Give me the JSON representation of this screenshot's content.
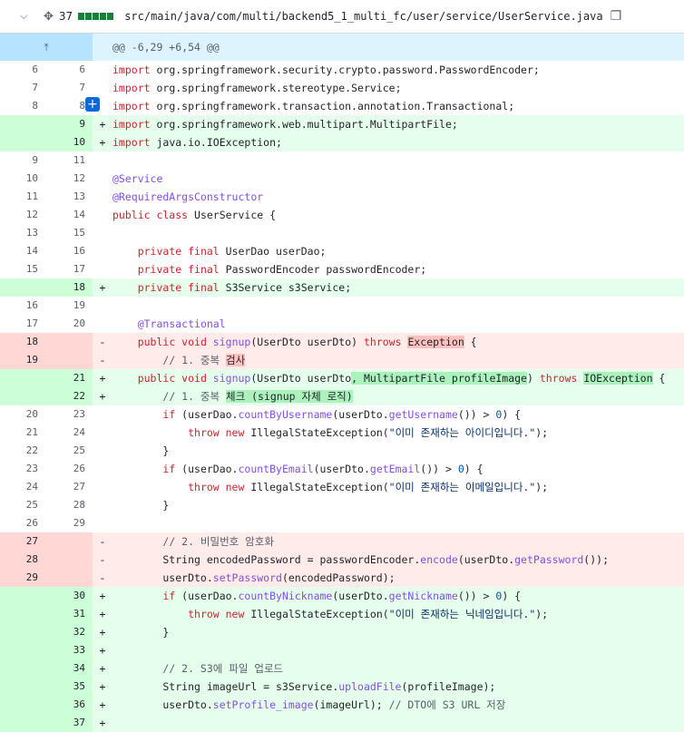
{
  "file": {
    "path": "src/main/java/com/multi/backend5_1_multi_fc/user/service/UserService.java",
    "changes": "37",
    "diffstat": [
      "add",
      "add",
      "add",
      "add",
      "add"
    ],
    "hunk": "@@ -6,29 +6,54 @@"
  },
  "lines": [
    {
      "t": "ctx",
      "o": "6",
      "n": "6",
      "s": "",
      "c": [
        [
          "kw",
          "import "
        ],
        [
          "",
          "org.springframework.security.crypto.password.PasswordEncoder;"
        ]
      ]
    },
    {
      "t": "ctx",
      "o": "7",
      "n": "7",
      "s": "",
      "c": [
        [
          "kw",
          "import "
        ],
        [
          "",
          "org.springframework.stereotype.Service;"
        ]
      ]
    },
    {
      "t": "ctx",
      "o": "8",
      "n": "8",
      "s": "",
      "c": [
        [
          "kw",
          "import "
        ],
        [
          "",
          "org.springframework.transaction.annotation.Transactional;"
        ]
      ]
    },
    {
      "t": "add",
      "o": "",
      "n": "9",
      "s": "+",
      "c": [
        [
          "kw",
          "import "
        ],
        [
          "",
          "org.springframework.web.multipart.MultipartFile;"
        ]
      ]
    },
    {
      "t": "add",
      "o": "",
      "n": "10",
      "s": "+",
      "c": [
        [
          "kw",
          "import "
        ],
        [
          "",
          "java.io.IOException;"
        ]
      ]
    },
    {
      "t": "ctx",
      "o": "9",
      "n": "11",
      "s": "",
      "c": []
    },
    {
      "t": "ctx",
      "o": "10",
      "n": "12",
      "s": "",
      "c": [
        [
          "an",
          "@Service"
        ]
      ]
    },
    {
      "t": "ctx",
      "o": "11",
      "n": "13",
      "s": "",
      "c": [
        [
          "an",
          "@RequiredArgsConstructor"
        ]
      ]
    },
    {
      "t": "ctx",
      "o": "12",
      "n": "14",
      "s": "",
      "c": [
        [
          "kw",
          "public class "
        ],
        [
          "",
          "UserService {"
        ]
      ]
    },
    {
      "t": "ctx",
      "o": "13",
      "n": "15",
      "s": "",
      "c": []
    },
    {
      "t": "ctx",
      "o": "14",
      "n": "16",
      "s": "",
      "c": [
        [
          "",
          "    "
        ],
        [
          "kw",
          "private final "
        ],
        [
          "",
          "UserDao userDao;"
        ]
      ]
    },
    {
      "t": "ctx",
      "o": "15",
      "n": "17",
      "s": "",
      "c": [
        [
          "",
          "    "
        ],
        [
          "kw",
          "private final "
        ],
        [
          "",
          "PasswordEncoder passwordEncoder;"
        ]
      ]
    },
    {
      "t": "add",
      "o": "",
      "n": "18",
      "s": "+",
      "c": [
        [
          "",
          "    "
        ],
        [
          "kw",
          "private final "
        ],
        [
          "",
          "S3Service s3Service;"
        ]
      ]
    },
    {
      "t": "ctx",
      "o": "16",
      "n": "19",
      "s": "",
      "c": []
    },
    {
      "t": "ctx",
      "o": "17",
      "n": "20",
      "s": "",
      "c": [
        [
          "",
          "    "
        ],
        [
          "an",
          "@Transactional"
        ]
      ]
    },
    {
      "t": "del",
      "o": "18",
      "n": "",
      "s": "-",
      "c": [
        [
          "",
          "    "
        ],
        [
          "kw",
          "public void "
        ],
        [
          "fn",
          "signup"
        ],
        [
          "",
          "(UserDto userDto) "
        ],
        [
          "kw",
          "throws "
        ],
        [
          "hl-del",
          "Exception"
        ],
        [
          "",
          " {"
        ]
      ]
    },
    {
      "t": "del",
      "o": "19",
      "n": "",
      "s": "-",
      "c": [
        [
          "",
          "        "
        ],
        [
          "cm",
          "// 1. 중복 "
        ],
        [
          "hl-del",
          "검사"
        ]
      ]
    },
    {
      "t": "add",
      "o": "",
      "n": "21",
      "s": "+",
      "c": [
        [
          "",
          "    "
        ],
        [
          "kw",
          "public void "
        ],
        [
          "fn",
          "signup"
        ],
        [
          "",
          "(UserDto userDto"
        ],
        [
          "hl-add",
          ", MultipartFile profileImage"
        ],
        [
          "",
          ") "
        ],
        [
          "kw",
          "throws "
        ],
        [
          "hl-add",
          "IOException"
        ],
        [
          "",
          " {"
        ]
      ]
    },
    {
      "t": "add",
      "o": "",
      "n": "22",
      "s": "+",
      "c": [
        [
          "",
          "        "
        ],
        [
          "cm",
          "// 1. 중복 "
        ],
        [
          "hl-add",
          "체크 (signup 자체 로직)"
        ]
      ]
    },
    {
      "t": "ctx",
      "o": "20",
      "n": "23",
      "s": "",
      "c": [
        [
          "",
          "        "
        ],
        [
          "kw",
          "if "
        ],
        [
          "",
          "(userDao."
        ],
        [
          "fn",
          "countByUsername"
        ],
        [
          "",
          "(userDto."
        ],
        [
          "fn",
          "getUsername"
        ],
        [
          "",
          "()) > "
        ],
        [
          "num",
          "0"
        ],
        [
          "",
          ") {"
        ]
      ]
    },
    {
      "t": "ctx",
      "o": "21",
      "n": "24",
      "s": "",
      "c": [
        [
          "",
          "            "
        ],
        [
          "kw",
          "throw new "
        ],
        [
          "",
          "IllegalStateException("
        ],
        [
          "str",
          "\"이미 존재하는 아이디입니다.\""
        ],
        [
          "",
          ");"
        ]
      ]
    },
    {
      "t": "ctx",
      "o": "22",
      "n": "25",
      "s": "",
      "c": [
        [
          "",
          "        }"
        ]
      ]
    },
    {
      "t": "ctx",
      "o": "23",
      "n": "26",
      "s": "",
      "c": [
        [
          "",
          "        "
        ],
        [
          "kw",
          "if "
        ],
        [
          "",
          "(userDao."
        ],
        [
          "fn",
          "countByEmail"
        ],
        [
          "",
          "(userDto."
        ],
        [
          "fn",
          "getEmail"
        ],
        [
          "",
          "()) > "
        ],
        [
          "num",
          "0"
        ],
        [
          "",
          ") {"
        ]
      ]
    },
    {
      "t": "ctx",
      "o": "24",
      "n": "27",
      "s": "",
      "c": [
        [
          "",
          "            "
        ],
        [
          "kw",
          "throw new "
        ],
        [
          "",
          "IllegalStateException("
        ],
        [
          "str",
          "\"이미 존재하는 이메일입니다.\""
        ],
        [
          "",
          ");"
        ]
      ]
    },
    {
      "t": "ctx",
      "o": "25",
      "n": "28",
      "s": "",
      "c": [
        [
          "",
          "        }"
        ]
      ]
    },
    {
      "t": "ctx",
      "o": "26",
      "n": "29",
      "s": "",
      "c": []
    },
    {
      "t": "del",
      "o": "27",
      "n": "",
      "s": "-",
      "c": [
        [
          "",
          "        "
        ],
        [
          "cm",
          "// 2. 비밀번호 암호화"
        ]
      ]
    },
    {
      "t": "del",
      "o": "28",
      "n": "",
      "s": "-",
      "c": [
        [
          "",
          "        String encodedPassword = passwordEncoder."
        ],
        [
          "fn",
          "encode"
        ],
        [
          "",
          "(userDto."
        ],
        [
          "fn",
          "getPassword"
        ],
        [
          "",
          "());"
        ]
      ]
    },
    {
      "t": "del",
      "o": "29",
      "n": "",
      "s": "-",
      "c": [
        [
          "",
          "        userDto."
        ],
        [
          "fn",
          "setPassword"
        ],
        [
          "",
          "(encodedPassword);"
        ]
      ]
    },
    {
      "t": "add",
      "o": "",
      "n": "30",
      "s": "+",
      "c": [
        [
          "",
          "        "
        ],
        [
          "kw",
          "if "
        ],
        [
          "",
          "(userDao."
        ],
        [
          "fn",
          "countByNickname"
        ],
        [
          "",
          "(userDto."
        ],
        [
          "fn",
          "getNickname"
        ],
        [
          "",
          "()) > "
        ],
        [
          "num",
          "0"
        ],
        [
          "",
          ") {"
        ]
      ]
    },
    {
      "t": "add",
      "o": "",
      "n": "31",
      "s": "+",
      "c": [
        [
          "",
          "            "
        ],
        [
          "kw",
          "throw new "
        ],
        [
          "",
          "IllegalStateException("
        ],
        [
          "str",
          "\"이미 존재하는 닉네임입니다.\""
        ],
        [
          "",
          ");"
        ]
      ]
    },
    {
      "t": "add",
      "o": "",
      "n": "32",
      "s": "+",
      "c": [
        [
          "",
          "        }"
        ]
      ]
    },
    {
      "t": "add",
      "o": "",
      "n": "33",
      "s": "+",
      "c": []
    },
    {
      "t": "add",
      "o": "",
      "n": "34",
      "s": "+",
      "c": [
        [
          "",
          "        "
        ],
        [
          "cm",
          "// 2. S3에 파일 업로드"
        ]
      ]
    },
    {
      "t": "add",
      "o": "",
      "n": "35",
      "s": "+",
      "c": [
        [
          "",
          "        String imageUrl = s3Service."
        ],
        [
          "fn",
          "uploadFile"
        ],
        [
          "",
          "(profileImage);"
        ]
      ]
    },
    {
      "t": "add",
      "o": "",
      "n": "36",
      "s": "+",
      "c": [
        [
          "",
          "        userDto."
        ],
        [
          "fn",
          "setProfile_image"
        ],
        [
          "",
          "(imageUrl); "
        ],
        [
          "cm",
          "// DTO에 S3 URL 저장"
        ]
      ]
    },
    {
      "t": "add",
      "o": "",
      "n": "37",
      "s": "+",
      "c": []
    }
  ]
}
